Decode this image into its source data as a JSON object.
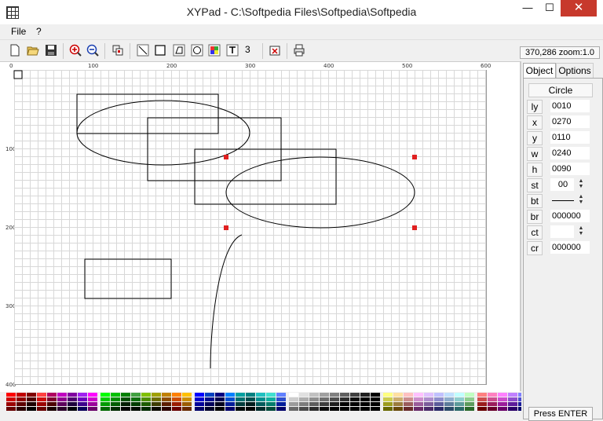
{
  "window": {
    "title": "XYPad - C:\\Softpedia Files\\Softpedia\\Softpedia",
    "minimize_glyph": "—",
    "maximize_glyph": "☐",
    "close_glyph": "✕"
  },
  "menu": {
    "file": "File",
    "help": "?"
  },
  "toolbar": {
    "icons": [
      "new-icon",
      "open-icon",
      "save-icon",
      "zoom-in-icon",
      "zoom-out-icon",
      "select-icon",
      "line-tool-icon",
      "rectangle-tool-icon",
      "polygon-tool-icon",
      "ellipse-tool-icon",
      "image-tool-icon",
      "text-tool-icon",
      "delete-icon",
      "print-icon"
    ],
    "line_width": "3",
    "status": "370,286 zoom:1.0"
  },
  "rulers": {
    "top": [
      "0",
      "100",
      "200",
      "300",
      "400",
      "500",
      "600"
    ],
    "left": [
      "100",
      "200",
      "300",
      "400"
    ]
  },
  "colors": {
    "selection": "#e02020",
    "shape_stroke": "#000000",
    "grid": "#d8d8d8"
  },
  "sidebar": {
    "tabs": [
      "Object",
      "Options"
    ],
    "object_title": "Circle",
    "props": [
      {
        "label": "ly",
        "value": "0010"
      },
      {
        "label": "x",
        "value": "0270"
      },
      {
        "label": "y",
        "value": "0110"
      },
      {
        "label": "w",
        "value": "0240"
      },
      {
        "label": "h",
        "value": "0090"
      },
      {
        "label": "st",
        "value": "00"
      },
      {
        "label": "bt",
        "value": ""
      },
      {
        "label": "br",
        "value": "000000"
      },
      {
        "label": "ct",
        "value": ""
      },
      {
        "label": "cr",
        "value": "000000"
      }
    ],
    "press_enter": "Press ENTER"
  }
}
